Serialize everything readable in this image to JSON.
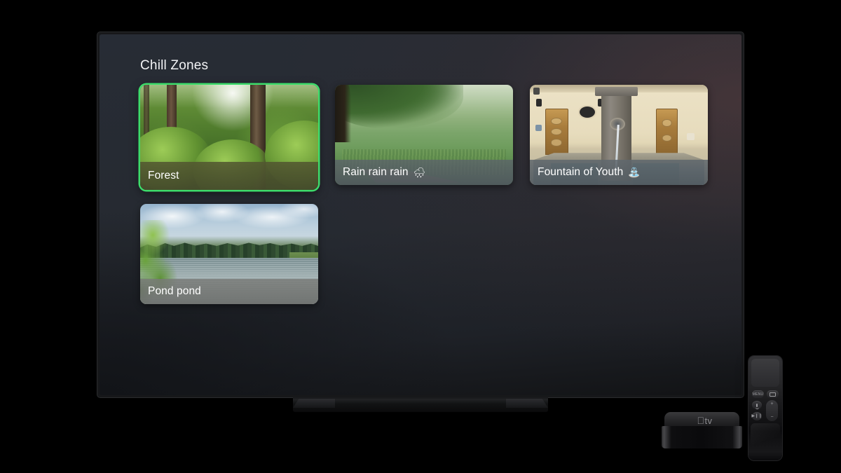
{
  "screen": {
    "title": "Chill Zones",
    "background_color": "#262a31",
    "focus_color": "#3ddc6b"
  },
  "cards": [
    {
      "title": "Forest",
      "emoji": "",
      "focused": true,
      "artwork": "green-forest-with-tall-tree-trunks",
      "label_tint": "#4e5430"
    },
    {
      "title": "Rain rain rain",
      "emoji": "🌧",
      "focused": false,
      "artwork": "green-meadow-with-stream-and-overhanging-tree",
      "label_tint": "#5a6062"
    },
    {
      "title": "Fountain of Youth",
      "emoji": "⛲",
      "focused": false,
      "artwork": "stone-fountain-in-front-of-beige-building",
      "label_tint": "#646a6e"
    },
    {
      "title": "Pond pond",
      "emoji": "",
      "focused": false,
      "artwork": "lake-with-pine-treeline-and-cloudy-sky",
      "label_tint": "#77797a"
    }
  ],
  "devices": {
    "apple_tv": {
      "logo_apple": "",
      "logo_text": "tv"
    },
    "remote": {
      "menu_label": "MENU",
      "tv_button": "tv-button",
      "mic_button": "mic-button",
      "play_pause_button": "play-pause-button",
      "volume_up": "+",
      "volume_down": "−"
    }
  }
}
